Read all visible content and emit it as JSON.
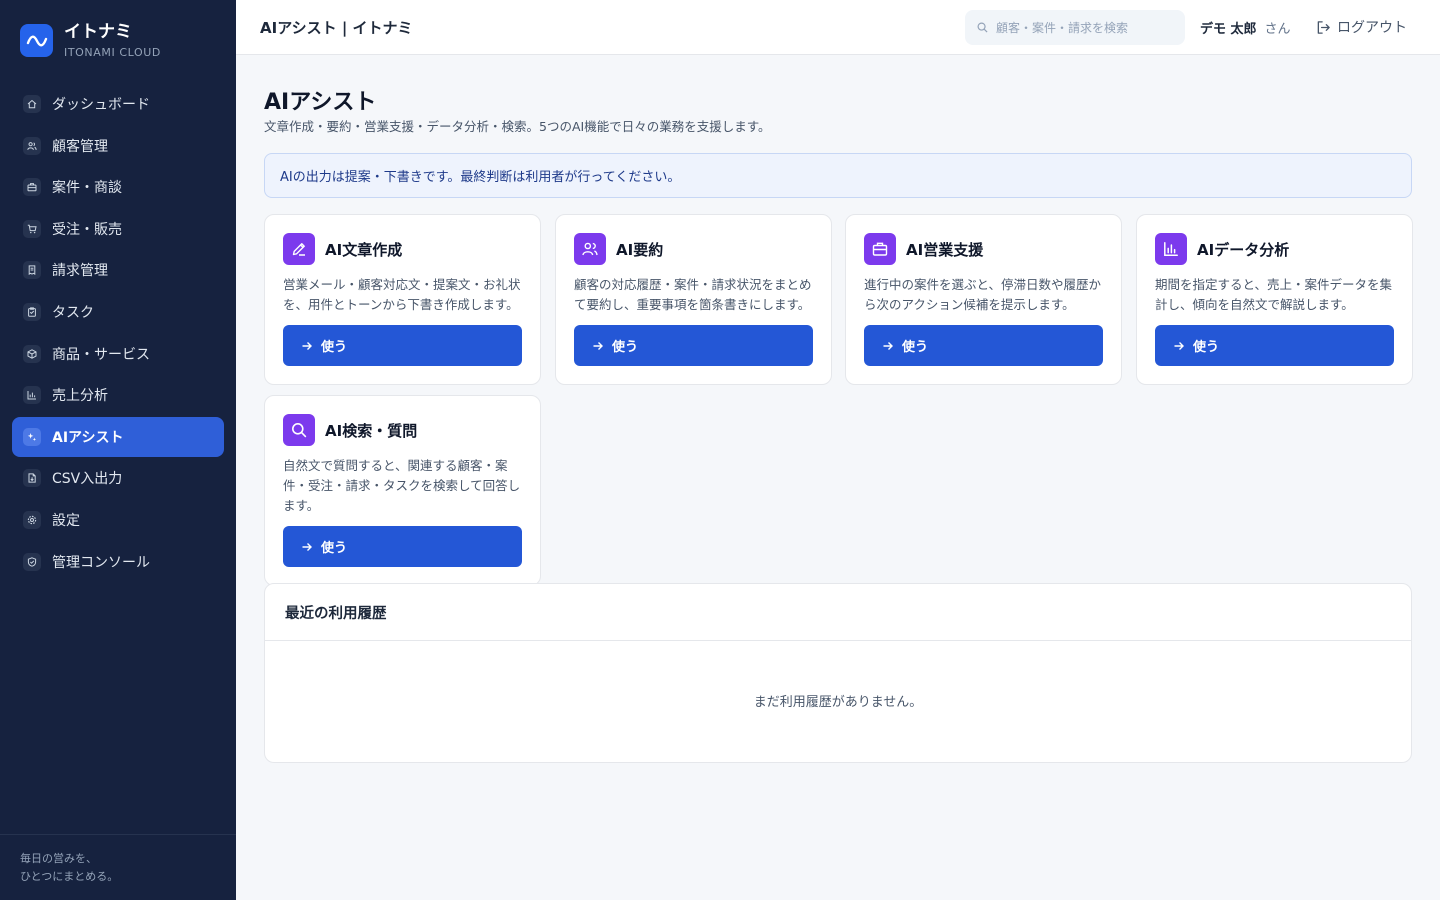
{
  "brand": {
    "name": "イトナミ",
    "sub": "ITONAMI CLOUD",
    "logo_icon": "wave-logo-icon"
  },
  "sidebar": {
    "items": [
      {
        "label": "ダッシュボード",
        "icon": "home-icon",
        "active": false
      },
      {
        "label": "顧客管理",
        "icon": "users-icon",
        "active": false
      },
      {
        "label": "案件・商談",
        "icon": "briefcase-icon",
        "active": false
      },
      {
        "label": "受注・販売",
        "icon": "cart-icon",
        "active": false
      },
      {
        "label": "請求管理",
        "icon": "receipt-icon",
        "active": false
      },
      {
        "label": "タスク",
        "icon": "clipboard-icon",
        "active": false
      },
      {
        "label": "商品・サービス",
        "icon": "box-icon",
        "active": false
      },
      {
        "label": "売上分析",
        "icon": "bar-chart-icon",
        "active": false
      },
      {
        "label": "AIアシスト",
        "icon": "sparkle-icon",
        "active": true
      },
      {
        "label": "CSV入出力",
        "icon": "file-icon",
        "active": false
      },
      {
        "label": "設定",
        "icon": "gear-icon",
        "active": false
      },
      {
        "label": "管理コンソール",
        "icon": "shield-icon",
        "active": false
      }
    ],
    "footer_line1": "毎日の営みを、",
    "footer_line2": "ひとつにまとめる。"
  },
  "header": {
    "title": "AIアシスト | イトナミ",
    "search_placeholder": "顧客・案件・請求を検索",
    "user_name": "デモ 太郎",
    "user_suffix": "さん",
    "logout_label": "ログアウト"
  },
  "main": {
    "title": "AIアシスト",
    "subtitle": "文章作成・要約・営業支援・データ分析・検索。5つのAI機能で日々の業務を支援します。",
    "notice": "AIの出力は提案・下書きです。最終判断は利用者が行ってください。",
    "cards": [
      {
        "title": "AI文章作成",
        "icon": "pencil-icon",
        "description": "営業メール・顧客対応文・提案文・お礼状を、用件とトーンから下書き作成します。",
        "button": "使う"
      },
      {
        "title": "AI要約",
        "icon": "users-icon",
        "description": "顧客の対応履歴・案件・請求状況をまとめて要約し、重要事項を箇条書きにします。",
        "button": "使う"
      },
      {
        "title": "AI営業支援",
        "icon": "briefcase-icon",
        "description": "進行中の案件を選ぶと、停滞日数や履歴から次のアクション候補を提示します。",
        "button": "使う"
      },
      {
        "title": "AIデータ分析",
        "icon": "bar-chart-icon",
        "description": "期間を指定すると、売上・案件データを集計し、傾向を自然文で解説します。",
        "button": "使う"
      },
      {
        "title": "AI検索・質問",
        "icon": "search-icon",
        "description": "自然文で質問すると、関連する顧客・案件・受注・請求・タスクを検索して回答します。",
        "button": "使う"
      }
    ],
    "history": {
      "title": "最近の利用履歴",
      "empty": "まだ利用履歴がありません。"
    }
  },
  "colors": {
    "sidebar_bg": "#16223f",
    "accent": "#2457d6",
    "card_icon": "#7c3aed"
  }
}
